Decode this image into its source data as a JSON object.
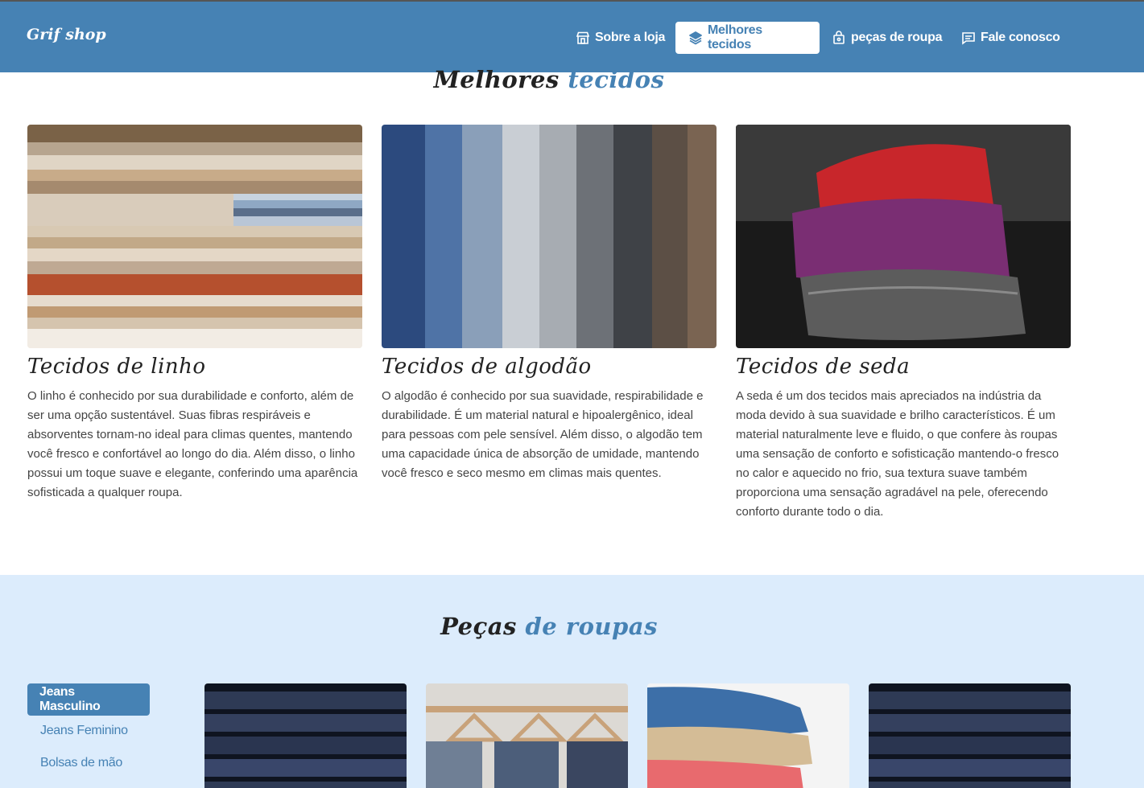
{
  "navbar": {
    "brand": "Grif shop",
    "items": [
      {
        "label": "Sobre a loja",
        "icon": "store-icon"
      },
      {
        "label": "Melhores tecidos",
        "icon": "layers-icon",
        "active": true
      },
      {
        "label": "peças de roupa",
        "icon": "bag-icon"
      },
      {
        "label": "Fale conosco",
        "icon": "chat-icon"
      }
    ],
    "colors": {
      "bar": "#4682b4",
      "text": "#ffffff"
    }
  },
  "fabrics": {
    "title_main": "Melhores",
    "title_accent": "tecidos",
    "cards": [
      {
        "title": "Tecidos de linho",
        "text": "O linho é conhecido por sua durabilidade e conforto, além de ser uma opção sustentável. Suas fibras respiráveis e absorventes tornam-no ideal para climas quentes, mantendo você fresco e confortável ao longo do dia. Além disso, o linho possui um toque suave e elegante, conferindo uma aparência sofisticada a qualquer roupa."
      },
      {
        "title": "Tecidos de algodão",
        "text": "O algodão é conhecido por sua suavidade, respirabilidade e durabilidade. É um material natural e hipoalergênico, ideal para pessoas com pele sensível. Além disso, o algodão tem uma capacidade única de absorção de umidade, mantendo você fresco e seco mesmo em climas mais quentes."
      },
      {
        "title": "Tecidos de seda",
        "text": "A seda é um dos tecidos mais apreciados na indústria da moda devido à sua suavidade e brilho característicos. É um material naturalmente leve e fluido, o que confere às roupas uma sensação de conforto e sofisticação mantendo-o fresco no calor e aquecido no frio, sua textura suave também proporciona uma sensação agradável na pele, oferecendo conforto durante todo o dia."
      }
    ]
  },
  "clothing": {
    "title_main": "Peças",
    "title_accent": "de roupas",
    "categories": [
      "Jeans Masculino",
      "Jeans Feminino",
      "Bolsas de mão"
    ],
    "active_category": "Jeans Masculino",
    "background": "#dcecfc"
  }
}
